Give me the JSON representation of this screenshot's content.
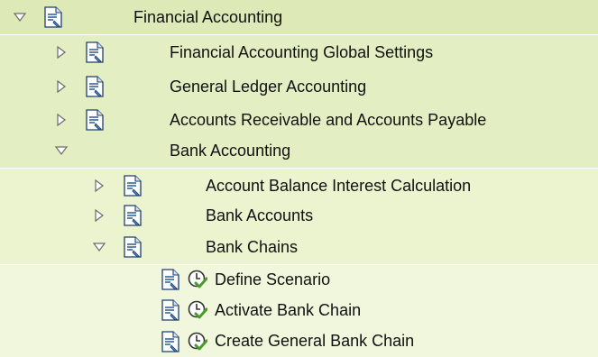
{
  "colors": {
    "level0_bg": "#dde9b6",
    "level1_bg": "#e4eec3",
    "level2_bg": "#ebf3cf",
    "level3_bg": "#f1f7dc",
    "icon_doc": "#2c5c94",
    "icon_check": "#4a9a2c"
  },
  "tree": {
    "root": {
      "label": "Financial Accounting",
      "expanded": true
    },
    "level1": [
      {
        "label": "Financial Accounting Global Settings",
        "expanded": false,
        "doc_icon": true
      },
      {
        "label": "General Ledger Accounting",
        "expanded": false,
        "doc_icon": true
      },
      {
        "label": "Accounts Receivable and Accounts Payable",
        "expanded": false,
        "doc_icon": true
      },
      {
        "label": "Bank Accounting",
        "expanded": true,
        "doc_icon": false
      }
    ],
    "bank_accounting_children": [
      {
        "label": "Account Balance Interest Calculation",
        "expanded": false
      },
      {
        "label": "Bank Accounts",
        "expanded": false
      },
      {
        "label": "Bank Chains",
        "expanded": true
      }
    ],
    "bank_chains_children": [
      {
        "label": "Define Scenario"
      },
      {
        "label": "Activate Bank Chain"
      },
      {
        "label": "Create General Bank Chain"
      }
    ]
  }
}
